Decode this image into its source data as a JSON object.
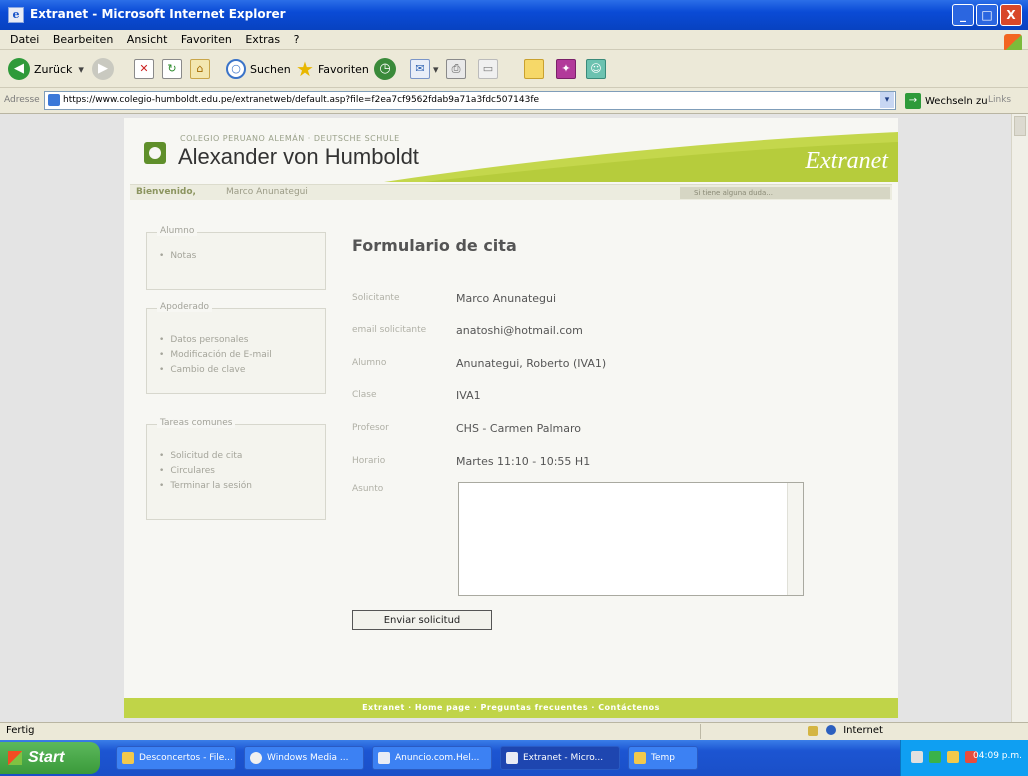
{
  "window": {
    "title": "Extranet - Microsoft Internet Explorer",
    "min": "_",
    "max": "□",
    "close": "X"
  },
  "menu": [
    "Datei",
    "Bearbeiten",
    "Ansicht",
    "Favoriten",
    "Extras",
    "?"
  ],
  "toolbar": {
    "back": "Zurück",
    "search": "Suchen",
    "favorites": "Favoriten"
  },
  "address": {
    "label": "Adresse",
    "url": "https://www.colegio-humboldt.edu.pe/extranetweb/default.asp?file=f2ea7cf9562fdab9a71a3fdc507143fe",
    "go_label": "Wechseln zu",
    "links_label": "Links"
  },
  "header": {
    "school_sub": "COLEGIO PERUANO ALEMÁN · DEUTSCHE SCHULE",
    "school_name": "Alexander von Humboldt",
    "site_name": "Extranet"
  },
  "welcome": {
    "greeting": "Bienvenido,",
    "user": "Marco Anunategui",
    "right_note": "Si tiene alguna duda..."
  },
  "sidebar": {
    "boxes": [
      {
        "title": "Alumno",
        "items": [
          "Notas"
        ]
      },
      {
        "title": "Apoderado",
        "items": [
          "Datos personales",
          "Modificación de E-mail",
          "Cambio de clave"
        ]
      },
      {
        "title": "Tareas comunes",
        "items": [
          "Solicitud de cita",
          "Circulares",
          "Terminar la sesión"
        ]
      }
    ]
  },
  "form": {
    "title": "Formulario de cita",
    "rows": [
      {
        "label": "Solicitante",
        "value": "Marco Anunategui"
      },
      {
        "label": "email solicitante",
        "value": "anatoshi@hotmail.com"
      },
      {
        "label": "Alumno",
        "value": "Anunategui, Roberto (IVA1)"
      },
      {
        "label": "Clase",
        "value": "IVA1"
      },
      {
        "label": "Profesor",
        "value": "CHS - Carmen Palmaro"
      },
      {
        "label": "Horario",
        "value": "Martes 11:10 - 10:55 H1"
      },
      {
        "label": "Asunto",
        "value": ""
      }
    ],
    "submit_label": "Enviar solicitud"
  },
  "footer": {
    "links": "Extranet · Home page · Preguntas frecuentes · Contáctenos"
  },
  "status": {
    "text": "Fertig",
    "zone": "Internet"
  },
  "taskbar": {
    "start": "Start",
    "tasks": [
      "Desconcertos - File...",
      "Windows Media ...",
      "Anuncio.com.Hel...",
      "Extranet - Micro...",
      "Temp"
    ],
    "clock": "04:09 p.m."
  },
  "colors": {
    "accent_green": "#c0d448",
    "xp_blue": "#0a4bd6"
  }
}
